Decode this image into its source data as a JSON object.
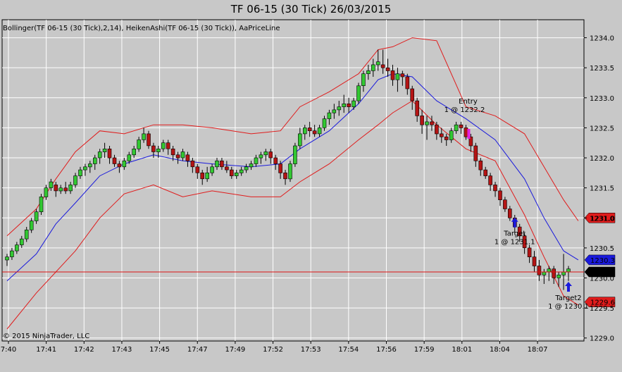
{
  "window": {
    "title": "TF 06-15 (30 Tick)  26/03/2015"
  },
  "chart": {
    "indicator_label": "Bollinger(TF 06-15 (30 Tick),2,14), HeikenAshi(TF 06-15 (30 Tick)), AaPriceLine",
    "copyright": "© 2015 NinjaTrader, LLC"
  },
  "chart_data": {
    "type": "candlestick",
    "y_ticks": [
      1229.0,
      1229.5,
      1230.0,
      1230.5,
      1231.0,
      1231.5,
      1232.0,
      1232.5,
      1233.0,
      1233.5,
      1234.0
    ],
    "y_tick_labels": [
      "1229.0",
      "1229.5",
      "1230.0",
      "1230.5",
      "1231.0",
      "1231.5",
      "1232.0",
      "1232.5",
      "1233.0",
      "1233.5",
      "1234.0"
    ],
    "ylim": [
      1228.95,
      1234.3
    ],
    "x_tick_labels": [
      "7:40",
      "17:41",
      "17:42",
      "17:43",
      "17:45",
      "17:47",
      "17:49",
      "17:52",
      "17:53",
      "17:54",
      "17:56",
      "17:59",
      "18:01",
      "18:04",
      "18:07"
    ],
    "candles_ohlc": [
      [
        1230.3,
        1230.4,
        1230.2,
        1230.35
      ],
      [
        1230.35,
        1230.5,
        1230.3,
        1230.45
      ],
      [
        1230.45,
        1230.6,
        1230.4,
        1230.55
      ],
      [
        1230.55,
        1230.7,
        1230.5,
        1230.65
      ],
      [
        1230.65,
        1230.85,
        1230.6,
        1230.8
      ],
      [
        1230.8,
        1231.0,
        1230.75,
        1230.95
      ],
      [
        1230.95,
        1231.15,
        1230.9,
        1231.1
      ],
      [
        1231.1,
        1231.4,
        1231.05,
        1231.35
      ],
      [
        1231.35,
        1231.55,
        1231.3,
        1231.5
      ],
      [
        1231.5,
        1231.65,
        1231.45,
        1231.6
      ],
      [
        1231.55,
        1231.6,
        1231.35,
        1231.45
      ],
      [
        1231.45,
        1231.55,
        1231.4,
        1231.5
      ],
      [
        1231.5,
        1231.6,
        1231.4,
        1231.45
      ],
      [
        1231.45,
        1231.6,
        1231.4,
        1231.55
      ],
      [
        1231.55,
        1231.75,
        1231.5,
        1231.7
      ],
      [
        1231.7,
        1231.85,
        1231.65,
        1231.8
      ],
      [
        1231.8,
        1231.9,
        1231.7,
        1231.85
      ],
      [
        1231.85,
        1231.95,
        1231.75,
        1231.9
      ],
      [
        1231.9,
        1232.05,
        1231.8,
        1232.0
      ],
      [
        1232.0,
        1232.15,
        1231.9,
        1232.1
      ],
      [
        1232.1,
        1232.25,
        1232.0,
        1232.15
      ],
      [
        1232.15,
        1232.2,
        1231.9,
        1232.0
      ],
      [
        1232.0,
        1232.05,
        1231.85,
        1231.9
      ],
      [
        1231.9,
        1231.95,
        1231.75,
        1231.85
      ],
      [
        1231.85,
        1232.0,
        1231.8,
        1231.95
      ],
      [
        1231.95,
        1232.1,
        1231.9,
        1232.05
      ],
      [
        1232.05,
        1232.2,
        1232.0,
        1232.15
      ],
      [
        1232.15,
        1232.35,
        1232.1,
        1232.3
      ],
      [
        1232.3,
        1232.5,
        1232.25,
        1232.4
      ],
      [
        1232.4,
        1232.45,
        1232.15,
        1232.2
      ],
      [
        1232.2,
        1232.25,
        1232.0,
        1232.1
      ],
      [
        1232.1,
        1232.2,
        1232.0,
        1232.15
      ],
      [
        1232.15,
        1232.3,
        1232.1,
        1232.25
      ],
      [
        1232.25,
        1232.3,
        1232.05,
        1232.15
      ],
      [
        1232.15,
        1232.2,
        1231.95,
        1232.05
      ],
      [
        1232.05,
        1232.1,
        1231.9,
        1232.0
      ],
      [
        1232.0,
        1232.15,
        1231.95,
        1232.1
      ],
      [
        1232.05,
        1232.1,
        1231.85,
        1231.95
      ],
      [
        1231.95,
        1232.0,
        1231.75,
        1231.85
      ],
      [
        1231.85,
        1231.9,
        1231.65,
        1231.75
      ],
      [
        1231.75,
        1231.8,
        1231.55,
        1231.65
      ],
      [
        1231.65,
        1231.85,
        1231.6,
        1231.75
      ],
      [
        1231.75,
        1231.9,
        1231.7,
        1231.85
      ],
      [
        1231.85,
        1232.0,
        1231.8,
        1231.95
      ],
      [
        1231.95,
        1232.0,
        1231.8,
        1231.85
      ],
      [
        1231.85,
        1231.95,
        1231.75,
        1231.8
      ],
      [
        1231.8,
        1231.85,
        1231.65,
        1231.7
      ],
      [
        1231.7,
        1231.8,
        1231.65,
        1231.75
      ],
      [
        1231.75,
        1231.85,
        1231.7,
        1231.8
      ],
      [
        1231.8,
        1231.9,
        1231.75,
        1231.85
      ],
      [
        1231.85,
        1231.95,
        1231.8,
        1231.9
      ],
      [
        1231.9,
        1232.05,
        1231.85,
        1232.0
      ],
      [
        1232.0,
        1232.1,
        1231.9,
        1232.05
      ],
      [
        1232.05,
        1232.15,
        1231.95,
        1232.1
      ],
      [
        1232.1,
        1232.15,
        1231.9,
        1232.0
      ],
      [
        1232.0,
        1232.05,
        1231.8,
        1231.9
      ],
      [
        1231.9,
        1231.95,
        1231.65,
        1231.75
      ],
      [
        1231.75,
        1231.8,
        1231.55,
        1231.65
      ],
      [
        1231.65,
        1231.95,
        1231.6,
        1231.9
      ],
      [
        1231.9,
        1232.25,
        1231.85,
        1232.2
      ],
      [
        1232.2,
        1232.5,
        1232.15,
        1232.4
      ],
      [
        1232.4,
        1232.55,
        1232.3,
        1232.5
      ],
      [
        1232.5,
        1232.6,
        1232.35,
        1232.45
      ],
      [
        1232.45,
        1232.55,
        1232.35,
        1232.4
      ],
      [
        1232.4,
        1232.55,
        1232.35,
        1232.5
      ],
      [
        1232.5,
        1232.7,
        1232.45,
        1232.65
      ],
      [
        1232.65,
        1232.8,
        1232.55,
        1232.75
      ],
      [
        1232.75,
        1232.9,
        1232.65,
        1232.8
      ],
      [
        1232.8,
        1232.95,
        1232.7,
        1232.85
      ],
      [
        1232.85,
        1233.05,
        1232.75,
        1232.9
      ],
      [
        1232.9,
        1233.0,
        1232.75,
        1232.85
      ],
      [
        1232.85,
        1233.0,
        1232.8,
        1232.95
      ],
      [
        1232.95,
        1233.25,
        1232.9,
        1233.2
      ],
      [
        1233.2,
        1233.45,
        1233.1,
        1233.4
      ],
      [
        1233.4,
        1233.55,
        1233.3,
        1233.45
      ],
      [
        1233.45,
        1233.65,
        1233.35,
        1233.55
      ],
      [
        1233.55,
        1233.8,
        1233.45,
        1233.6
      ],
      [
        1233.55,
        1233.8,
        1233.4,
        1233.5
      ],
      [
        1233.5,
        1233.65,
        1233.35,
        1233.45
      ],
      [
        1233.45,
        1233.55,
        1233.2,
        1233.3
      ],
      [
        1233.3,
        1233.5,
        1233.1,
        1233.4
      ],
      [
        1233.4,
        1233.45,
        1233.2,
        1233.35
      ],
      [
        1233.35,
        1233.4,
        1233.05,
        1233.15
      ],
      [
        1233.15,
        1233.2,
        1232.8,
        1232.95
      ],
      [
        1232.95,
        1233.0,
        1232.6,
        1232.7
      ],
      [
        1232.7,
        1232.8,
        1232.4,
        1232.55
      ],
      [
        1232.55,
        1232.7,
        1232.3,
        1232.6
      ],
      [
        1232.6,
        1232.7,
        1232.45,
        1232.55
      ],
      [
        1232.55,
        1232.6,
        1232.3,
        1232.4
      ],
      [
        1232.4,
        1232.5,
        1232.25,
        1232.35
      ],
      [
        1232.35,
        1232.4,
        1232.2,
        1232.3
      ],
      [
        1232.3,
        1232.5,
        1232.25,
        1232.45
      ],
      [
        1232.45,
        1232.6,
        1232.4,
        1232.55
      ],
      [
        1232.55,
        1232.6,
        1232.4,
        1232.5
      ],
      [
        1232.5,
        1232.55,
        1232.3,
        1232.35
      ],
      [
        1232.35,
        1232.4,
        1232.1,
        1232.2
      ],
      [
        1232.2,
        1232.25,
        1231.85,
        1231.95
      ],
      [
        1231.95,
        1232.0,
        1231.7,
        1231.8
      ],
      [
        1231.8,
        1231.85,
        1231.65,
        1231.7
      ],
      [
        1231.7,
        1231.75,
        1231.45,
        1231.55
      ],
      [
        1231.55,
        1231.6,
        1231.35,
        1231.45
      ],
      [
        1231.45,
        1231.5,
        1231.2,
        1231.3
      ],
      [
        1231.3,
        1231.35,
        1231.1,
        1231.15
      ],
      [
        1231.15,
        1231.2,
        1230.95,
        1231.0
      ],
      [
        1231.0,
        1231.05,
        1230.75,
        1230.85
      ],
      [
        1230.85,
        1230.9,
        1230.6,
        1230.7
      ],
      [
        1230.7,
        1230.75,
        1230.4,
        1230.5
      ],
      [
        1230.5,
        1230.55,
        1230.25,
        1230.35
      ],
      [
        1230.35,
        1230.45,
        1230.1,
        1230.2
      ],
      [
        1230.2,
        1230.3,
        1229.95,
        1230.05
      ],
      [
        1230.05,
        1230.15,
        1229.9,
        1230.1
      ],
      [
        1230.1,
        1230.2,
        1229.95,
        1230.15
      ],
      [
        1230.15,
        1230.2,
        1229.9,
        1230.0
      ],
      [
        1230.0,
        1230.1,
        1229.85,
        1230.05
      ],
      [
        1230.05,
        1230.4,
        1229.8,
        1230.1
      ],
      [
        1230.1,
        1230.2,
        1229.95,
        1230.15
      ]
    ],
    "bollinger_mid": [
      [
        0,
        1229.95
      ],
      [
        6,
        1230.4
      ],
      [
        10,
        1230.9
      ],
      [
        14,
        1231.25
      ],
      [
        19,
        1231.7
      ],
      [
        24,
        1231.9
      ],
      [
        30,
        1232.05
      ],
      [
        36,
        1231.95
      ],
      [
        42,
        1231.9
      ],
      [
        50,
        1231.85
      ],
      [
        56,
        1231.9
      ],
      [
        60,
        1232.15
      ],
      [
        66,
        1232.45
      ],
      [
        72,
        1232.9
      ],
      [
        76,
        1233.3
      ],
      [
        79,
        1233.4
      ],
      [
        83,
        1233.35
      ],
      [
        88,
        1232.95
      ],
      [
        94,
        1232.65
      ],
      [
        100,
        1232.3
      ],
      [
        106,
        1231.65
      ],
      [
        110,
        1231.0
      ],
      [
        114,
        1230.45
      ],
      [
        117,
        1230.3
      ]
    ],
    "bollinger_upper": [
      [
        0,
        1230.7
      ],
      [
        6,
        1231.15
      ],
      [
        10,
        1231.65
      ],
      [
        14,
        1232.1
      ],
      [
        19,
        1232.45
      ],
      [
        24,
        1232.4
      ],
      [
        30,
        1232.55
      ],
      [
        36,
        1232.55
      ],
      [
        42,
        1232.5
      ],
      [
        50,
        1232.4
      ],
      [
        56,
        1232.45
      ],
      [
        60,
        1232.85
      ],
      [
        66,
        1233.1
      ],
      [
        72,
        1233.4
      ],
      [
        76,
        1233.8
      ],
      [
        79,
        1233.85
      ],
      [
        83,
        1234.0
      ],
      [
        88,
        1233.95
      ],
      [
        94,
        1232.85
      ],
      [
        100,
        1232.7
      ],
      [
        106,
        1232.4
      ],
      [
        110,
        1231.85
      ],
      [
        114,
        1231.3
      ],
      [
        117,
        1230.95
      ]
    ],
    "bollinger_lower": [
      [
        0,
        1229.15
      ],
      [
        6,
        1229.75
      ],
      [
        10,
        1230.1
      ],
      [
        14,
        1230.45
      ],
      [
        19,
        1231.0
      ],
      [
        24,
        1231.4
      ],
      [
        30,
        1231.55
      ],
      [
        36,
        1231.35
      ],
      [
        42,
        1231.45
      ],
      [
        50,
        1231.35
      ],
      [
        56,
        1231.35
      ],
      [
        60,
        1231.6
      ],
      [
        66,
        1231.9
      ],
      [
        72,
        1232.3
      ],
      [
        76,
        1232.55
      ],
      [
        79,
        1232.75
      ],
      [
        83,
        1232.95
      ],
      [
        88,
        1232.55
      ],
      [
        94,
        1232.15
      ],
      [
        100,
        1231.95
      ],
      [
        106,
        1231.05
      ],
      [
        110,
        1230.35
      ],
      [
        114,
        1229.7
      ],
      [
        117,
        1229.55
      ]
    ],
    "price_line": 1230.1,
    "price_labels": [
      {
        "value": 1231.0,
        "text": "1231.0",
        "color": "#e01c1c",
        "text_color": "#ffffff"
      },
      {
        "value": 1230.3,
        "text": "1230.3",
        "color": "#1a1adc",
        "text_color": "#ffffff"
      },
      {
        "value": 1230.1,
        "text": "1230.1",
        "color": "#000000",
        "text_color": "#ffffff"
      },
      {
        "value": 1229.6,
        "text": "1229.6",
        "color": "#e01c1c",
        "text_color": "#ffffff"
      }
    ],
    "annotations": {
      "entry": {
        "label": "Entry",
        "detail": "1 @ 1232.2",
        "price": 1232.2,
        "bar": 94
      },
      "target1": {
        "label": "Target",
        "detail": "1 @ 1231.1",
        "price": 1231.1,
        "bar": 104
      },
      "target2": {
        "label": "Target2",
        "detail": "1 @ 1230.1",
        "price": 1230.1,
        "bar": 115
      }
    },
    "colors": {
      "background": "#c8c8c8",
      "grid": "#ffffff",
      "up_candle": "#32c832",
      "down_candle": "#b41414",
      "bollinger_band": "#e01c1c",
      "bollinger_mid": "#1a1adc",
      "price_line": "#dc1414",
      "entry_marker": "#e020e0",
      "target_marker": "#1a1adc"
    }
  }
}
